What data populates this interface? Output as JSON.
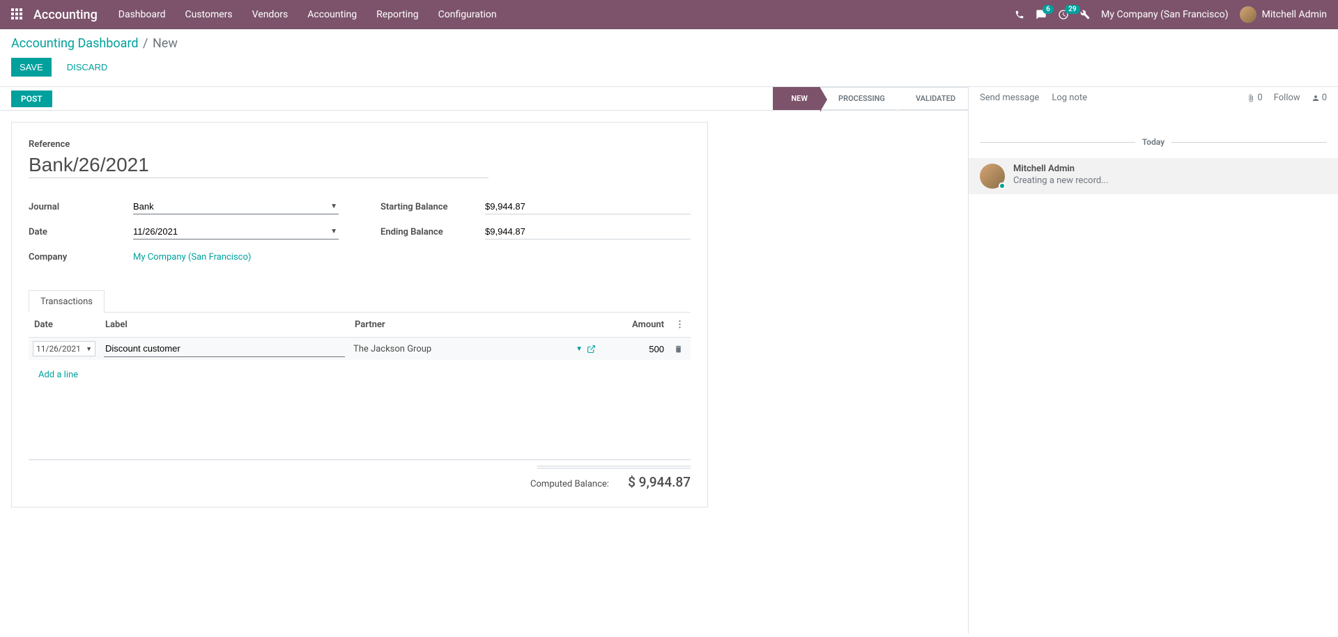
{
  "navbar": {
    "brand": "Accounting",
    "menu": [
      "Dashboard",
      "Customers",
      "Vendors",
      "Accounting",
      "Reporting",
      "Configuration"
    ],
    "messages_badge": "6",
    "activities_badge": "29",
    "company": "My Company (San Francisco)",
    "user": "Mitchell Admin"
  },
  "breadcrumb": {
    "parent": "Accounting Dashboard",
    "current": "New"
  },
  "buttons": {
    "save": "SAVE",
    "discard": "DISCARD",
    "post": "POST"
  },
  "stages": {
    "new": "NEW",
    "processing": "PROCESSING",
    "validated": "VALIDATED"
  },
  "form": {
    "reference_label": "Reference",
    "reference_value": "Bank/26/2021",
    "journal_label": "Journal",
    "journal_value": "Bank",
    "date_label": "Date",
    "date_value": "11/26/2021",
    "company_label": "Company",
    "company_value": "My Company (San Francisco)",
    "starting_balance_label": "Starting Balance",
    "starting_balance_value": "$9,944.87",
    "ending_balance_label": "Ending Balance",
    "ending_balance_value": "$9,944.87"
  },
  "tabs": {
    "transactions": "Transactions"
  },
  "table": {
    "headers": {
      "date": "Date",
      "label": "Label",
      "partner": "Partner",
      "amount": "Amount"
    },
    "row": {
      "date": "11/26/2021",
      "label": "Discount customer",
      "partner": "The Jackson Group",
      "amount": "500"
    },
    "add_line": "Add a line"
  },
  "footer": {
    "computed_label": "Computed Balance:",
    "computed_value": "$ 9,944.87"
  },
  "chatter": {
    "send": "Send message",
    "log": "Log note",
    "attach_count": "0",
    "follow": "Follow",
    "follower_count": "0",
    "today": "Today",
    "msg_author": "Mitchell Admin",
    "msg_text": "Creating a new record..."
  }
}
